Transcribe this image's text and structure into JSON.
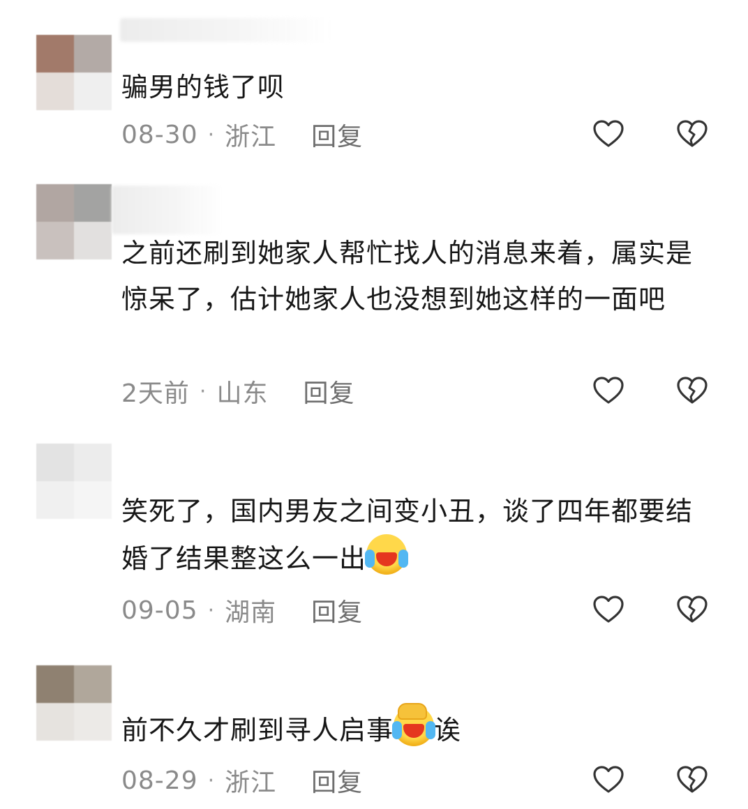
{
  "colors": {
    "text": "#161616",
    "meta": "#8a8a8a",
    "reply": "#6e6e6e",
    "icon": "#333333"
  },
  "icons": {
    "like": "heart-outline-icon",
    "dislike": "broken-heart-outline-icon"
  },
  "comments": [
    {
      "avatar_colors": [
        "#a27a6a",
        "#b3aaa6",
        "#e4ddd9",
        "#efefef"
      ],
      "text": "骗男的钱了呗",
      "date": "08-30",
      "separator": "·",
      "location": "浙江",
      "reply_label": "回复"
    },
    {
      "avatar_colors": [
        "#b1a6a2",
        "#a3a3a2",
        "#c9c1be",
        "#e2e0df"
      ],
      "text": "之前还刷到她家人帮忙找人的消息来着，属实是惊呆了，估计她家人也没想到她这样的一面吧",
      "date": "2天前",
      "separator": "·",
      "location": "山东",
      "reply_label": "回复"
    },
    {
      "avatar_colors": [
        "#e3e3e3",
        "#ececec",
        "#f0f0f0",
        "#f5f5f5"
      ],
      "text": "笑死了，国内男友之间变小丑，谈了四年都要结婚了结果整这么一出",
      "emoji": "loudly-crying-laugh-emoji",
      "date": "09-05",
      "separator": "·",
      "location": "湖南",
      "reply_label": "回复"
    },
    {
      "avatar_colors": [
        "#8f8171",
        "#b0a79b",
        "#e6e3df",
        "#eceae7"
      ],
      "text": "前不久才刷到寻人启事",
      "emoji": "facepalm-laugh-emoji",
      "text_after": "诶",
      "date": "08-29",
      "separator": "·",
      "location": "浙江",
      "reply_label": "回复"
    }
  ]
}
